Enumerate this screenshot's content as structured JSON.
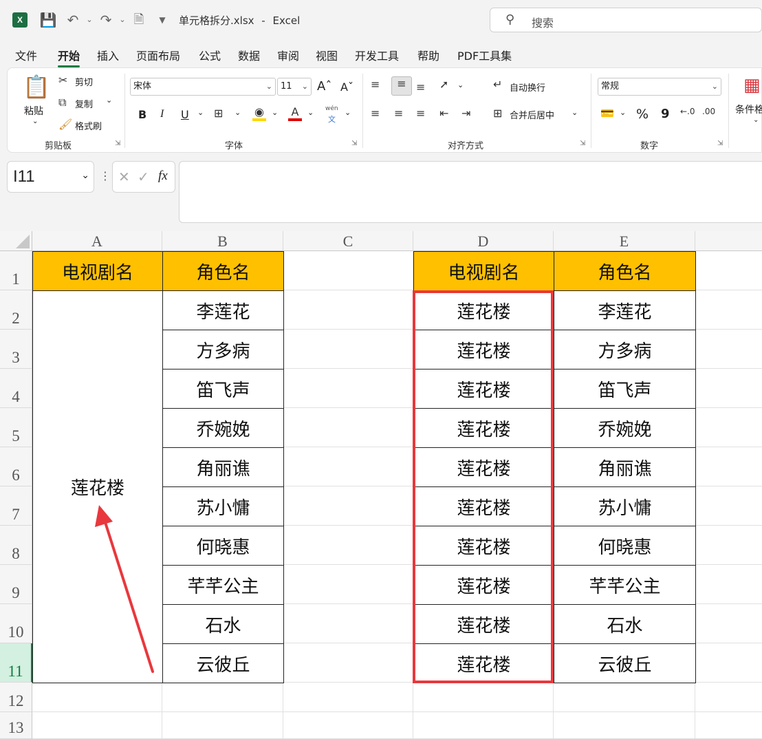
{
  "titlebar": {
    "app_icon": "X",
    "filename": "单元格拆分.xlsx",
    "separator": "-",
    "app_name": "Excel",
    "search_placeholder": "搜索"
  },
  "menu": {
    "tabs": [
      "文件",
      "开始",
      "插入",
      "页面布局",
      "公式",
      "数据",
      "审阅",
      "视图",
      "开发工具",
      "帮助",
      "PDF工具集"
    ],
    "active": "开始"
  },
  "ribbon": {
    "clipboard": {
      "paste": "粘贴",
      "cut": "剪切",
      "copy": "复制",
      "format_painter": "格式刷",
      "label": "剪贴板"
    },
    "font": {
      "font_name": "宋体",
      "font_size": "11",
      "bold": "B",
      "italic": "I",
      "underline": "U",
      "label": "字体",
      "wen": "wén",
      "wen_sub": "文"
    },
    "alignment": {
      "wrap_text": "自动换行",
      "merge_center": "合并后居中",
      "label": "对齐方式"
    },
    "number": {
      "format": "常规",
      "percent": "%",
      "comma": "9",
      "label": "数字"
    },
    "styles": {
      "conditional_format": "条件格"
    }
  },
  "formula_bar": {
    "name_box": "I11",
    "fx": "fx",
    "cancel": "✕",
    "confirm": "✓",
    "value": ""
  },
  "sheet": {
    "columns": [
      "A",
      "B",
      "C",
      "D",
      "E"
    ],
    "rows": [
      "1",
      "2",
      "3",
      "4",
      "5",
      "6",
      "7",
      "8",
      "9",
      "10",
      "11",
      "12",
      "13"
    ],
    "selected_row": "11",
    "header_a": "电视剧名",
    "header_b": "角色名",
    "header_d": "电视剧名",
    "header_e": "角色名",
    "merged_a": "莲花楼",
    "characters": [
      "李莲花",
      "方多病",
      "笛飞声",
      "乔婉娩",
      "角丽谯",
      "苏小慵",
      "何晓惠",
      "芊芊公主",
      "石水",
      "云彼丘"
    ],
    "show_name_repeated": "莲花楼",
    "highlight_color": "#e8383d",
    "header_fill": "#ffc000",
    "accent": "#107c41"
  }
}
